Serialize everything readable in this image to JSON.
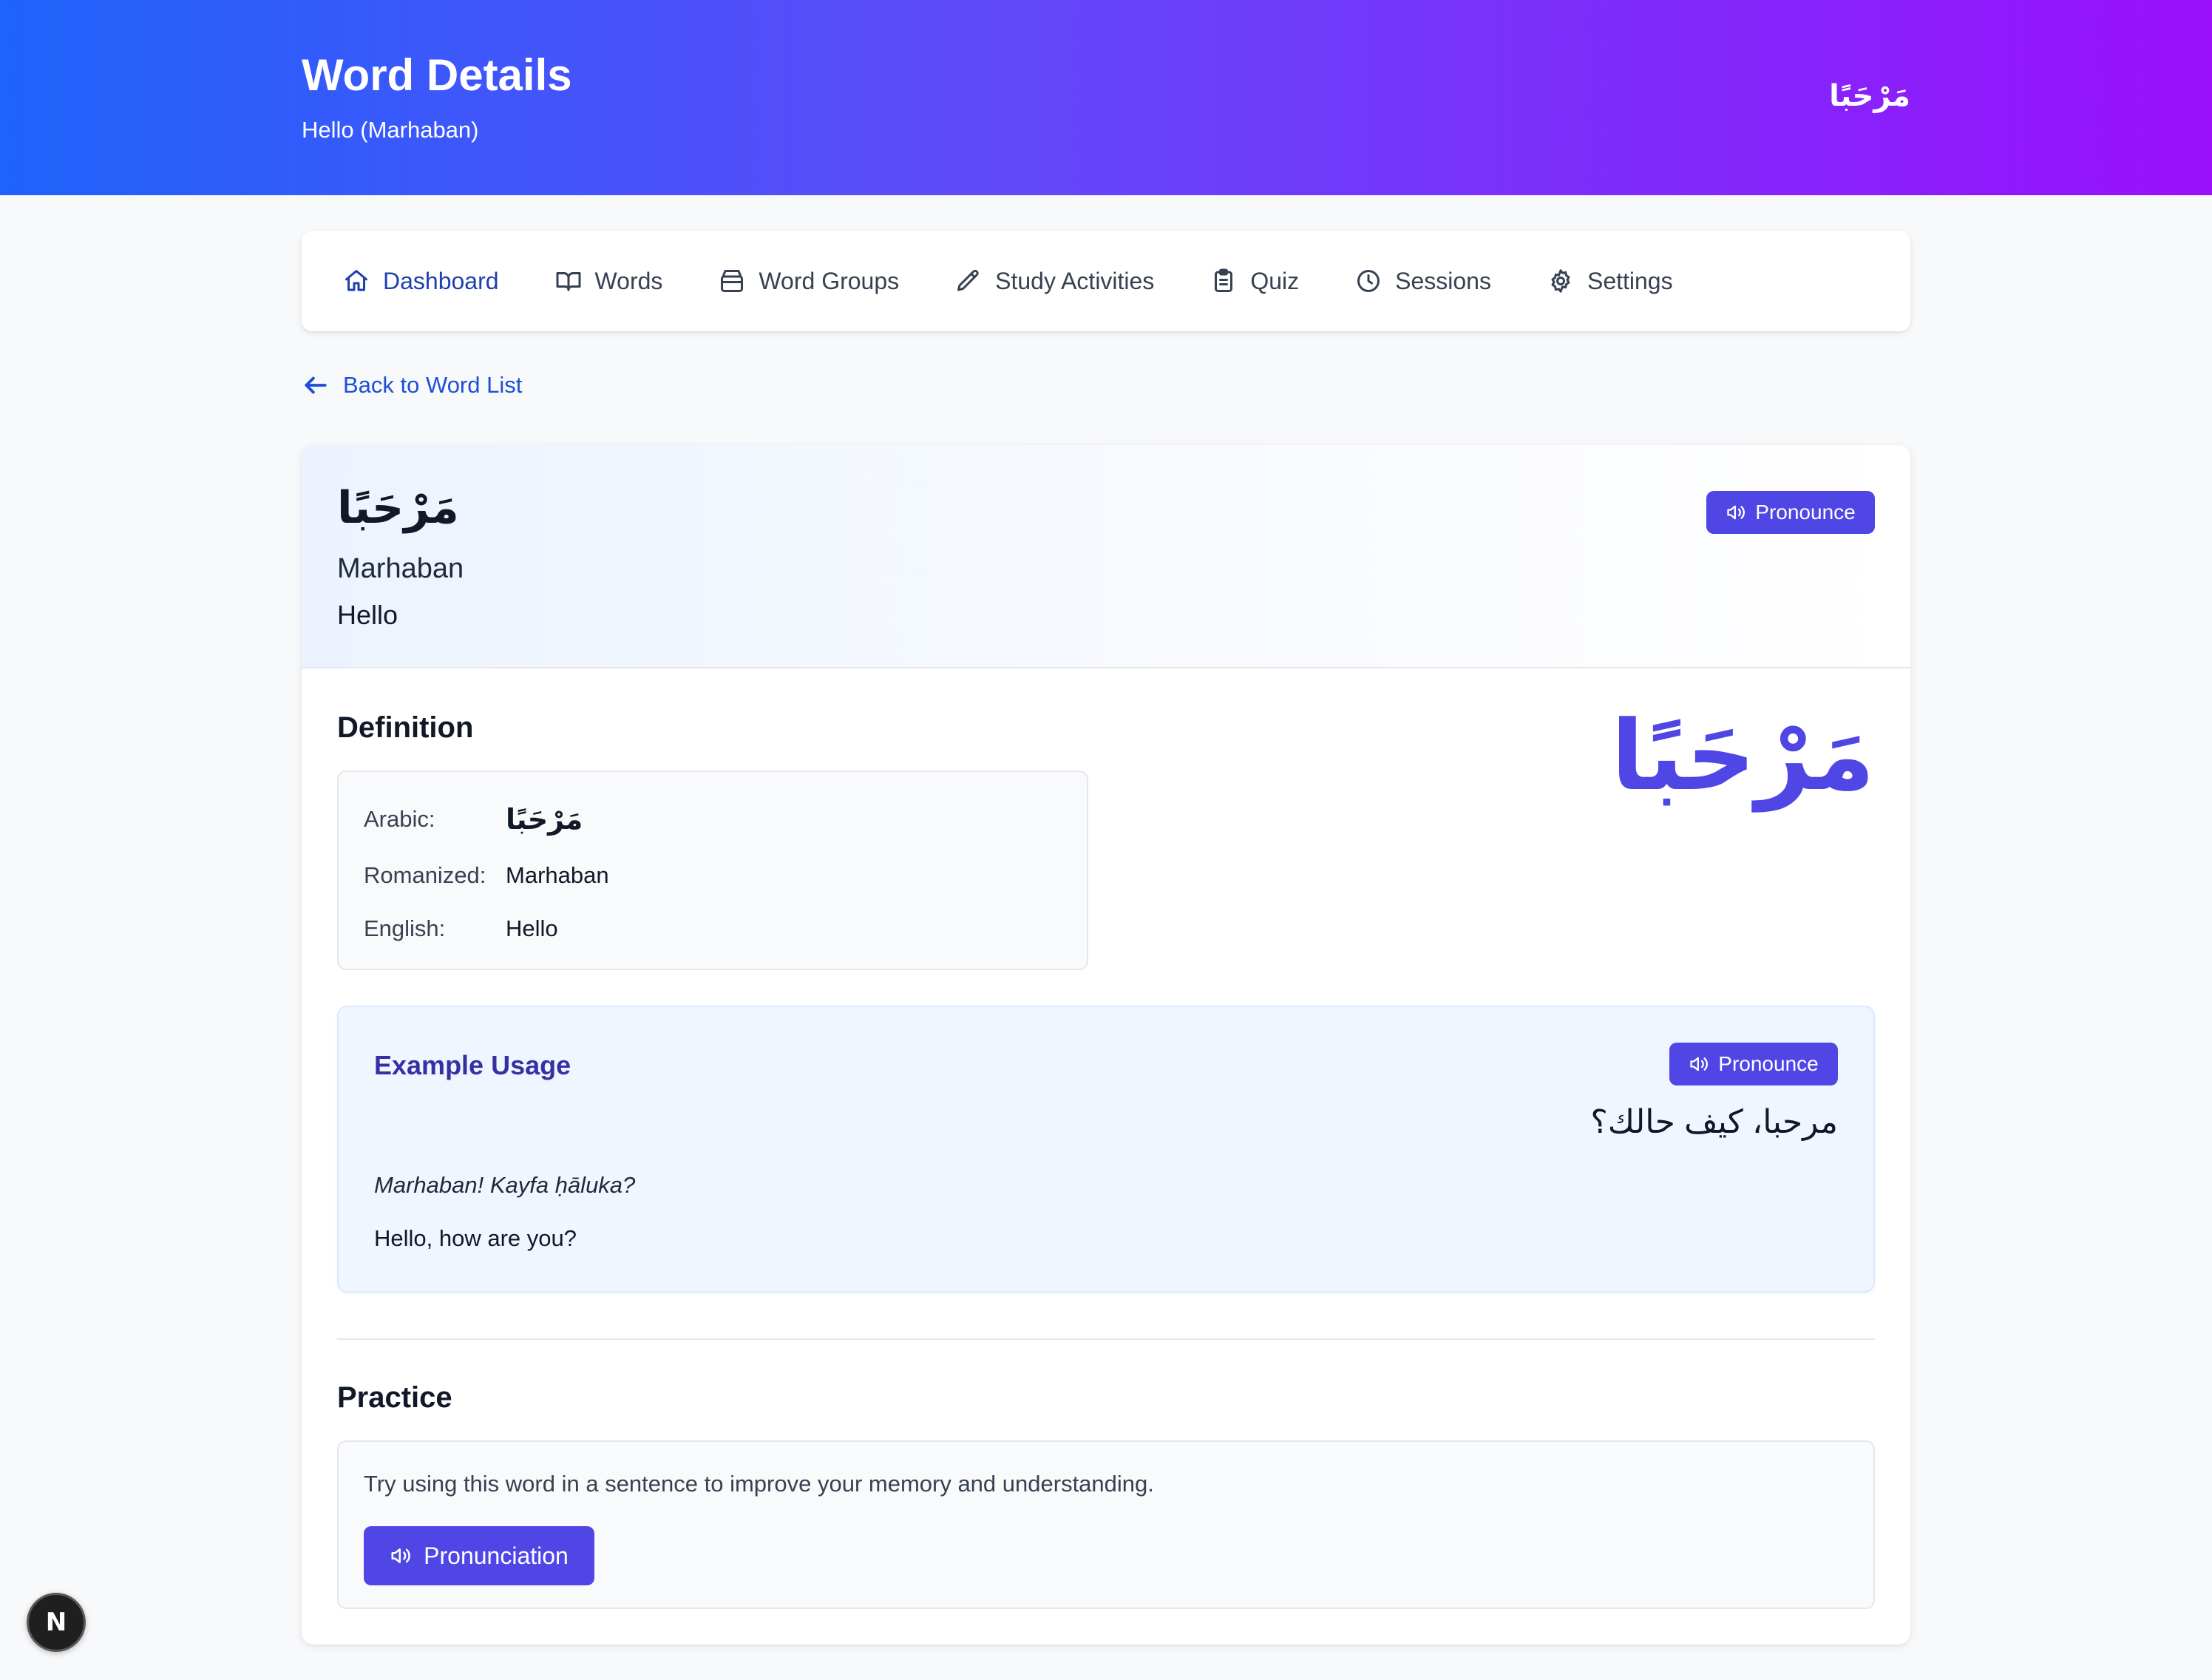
{
  "header": {
    "title": "Word Details",
    "subtitle": "Hello (Marhaban)",
    "arabic": "مَرْحَبًا"
  },
  "nav": {
    "items": [
      {
        "label": "Dashboard",
        "icon": "home-icon",
        "active": true
      },
      {
        "label": "Words",
        "icon": "book-icon"
      },
      {
        "label": "Word Groups",
        "icon": "archive-icon"
      },
      {
        "label": "Study Activities",
        "icon": "pencil-icon"
      },
      {
        "label": "Quiz",
        "icon": "clipboard-icon"
      },
      {
        "label": "Sessions",
        "icon": "clock-icon"
      },
      {
        "label": "Settings",
        "icon": "gear-icon"
      }
    ]
  },
  "back_link": {
    "label": "Back to Word List",
    "icon": "arrow-left-icon"
  },
  "word": {
    "arabic": "مَرْحَبًا",
    "romanized": "Marhaban",
    "english": "Hello",
    "pronounce_label": "Pronounce"
  },
  "definition": {
    "title": "Definition",
    "arabic_label": "Arabic:",
    "arabic_value": "مَرْحَبًا",
    "romanized_label": "Romanized:",
    "romanized_value": "Marhaban",
    "english_label": "English:",
    "english_value": "Hello",
    "large_arabic": "مَرْحَبًا"
  },
  "example": {
    "title": "Example Usage",
    "pronounce_label": "Pronounce",
    "arabic": "مرحبا، كيف حالك؟",
    "romanized": "Marhaban! Kayfa ḥāluka?",
    "english": "Hello, how are you?"
  },
  "practice": {
    "title": "Practice",
    "text": "Try using this word in a sentence to improve your memory and understanding.",
    "button_label": "Pronunciation"
  },
  "badge": {
    "label": "N"
  },
  "colors": {
    "accent": "#4f46e5",
    "link": "#1d4ed8",
    "header_start": "#1e63fb",
    "header_end": "#9a10fb"
  }
}
